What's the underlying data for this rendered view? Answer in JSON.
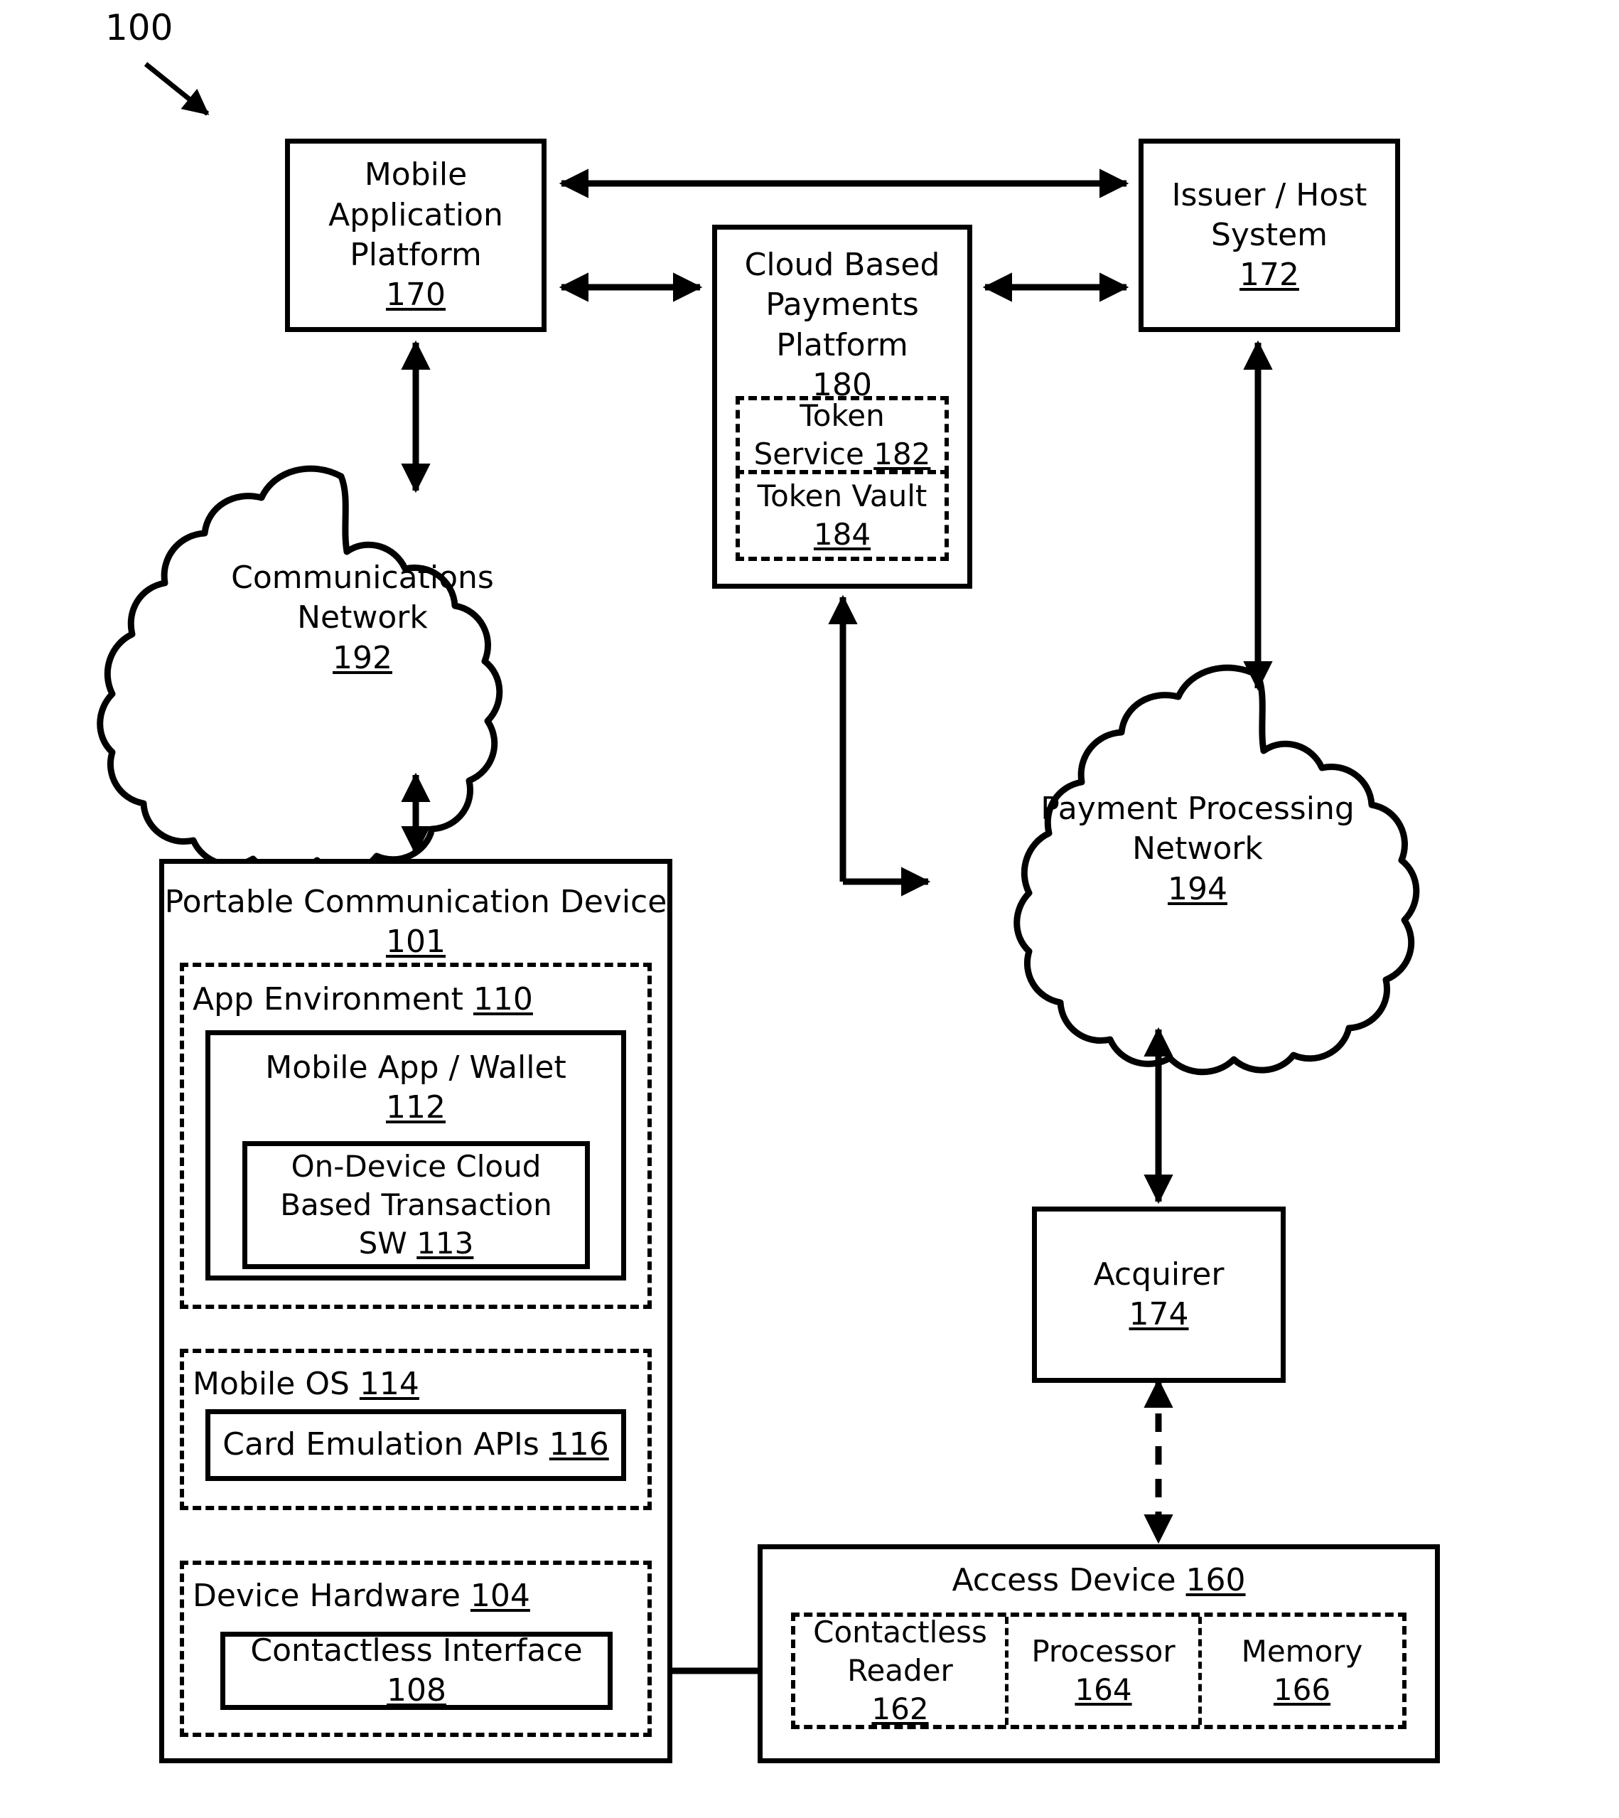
{
  "figure": {
    "number": "100",
    "type": "patent-block-diagram",
    "title": "Cloud Based Payments System Architecture"
  },
  "nodes": {
    "mobile_app_platform": {
      "line1": "Mobile",
      "line2": "Application",
      "line3": "Platform",
      "ref": "170"
    },
    "cloud_payments_platform": {
      "line1": "Cloud Based",
      "line2": "Payments",
      "line3": "Platform",
      "ref": "180"
    },
    "token_service": {
      "line1": "Token",
      "line2": "Service ",
      "ref": "182"
    },
    "token_vault": {
      "line1": "Token Vault",
      "ref": "184"
    },
    "issuer_host": {
      "line1": "Issuer / Host",
      "line2": "System",
      "ref": "172"
    },
    "communications_network": {
      "line1": "Communications",
      "line2": "Network",
      "ref": "192"
    },
    "payment_processing_network": {
      "line1": "Payment Processing",
      "line2": "Network",
      "ref": "194"
    },
    "acquirer": {
      "line1": "Acquirer",
      "ref": "174"
    },
    "portable_communication_device": {
      "line1": "Portable Communication Device",
      "ref": "101"
    },
    "app_environment": {
      "line1": "App Environment ",
      "ref": "110"
    },
    "mobile_app_wallet": {
      "line1": "Mobile App / Wallet",
      "ref": "112"
    },
    "on_device_sw": {
      "line1": "On-Device Cloud",
      "line2": "Based Transaction",
      "line3": "SW ",
      "ref": "113"
    },
    "mobile_os": {
      "line1": "Mobile OS ",
      "ref": "114"
    },
    "card_emulation_apis": {
      "line1": "Card Emulation APIs ",
      "ref": "116"
    },
    "device_hardware": {
      "line1": "Device Hardware ",
      "ref": "104"
    },
    "contactless_interface": {
      "line1": "Contactless Interface ",
      "ref": "108"
    },
    "access_device": {
      "line1": "Access Device ",
      "ref": "160"
    },
    "contactless_reader": {
      "line1": "Contactless",
      "line2": "Reader",
      "ref": "162"
    },
    "processor": {
      "line1": "Processor",
      "ref": "164"
    },
    "memory": {
      "line1": "Memory",
      "ref": "166"
    }
  },
  "connections": [
    {
      "from": "mobile_app_platform",
      "to": "issuer_host",
      "style": "double-arrow"
    },
    {
      "from": "mobile_app_platform",
      "to": "cloud_payments_platform",
      "style": "double-arrow"
    },
    {
      "from": "cloud_payments_platform",
      "to": "issuer_host",
      "style": "double-arrow"
    },
    {
      "from": "mobile_app_platform",
      "to": "communications_network",
      "style": "double-arrow"
    },
    {
      "from": "communications_network",
      "to": "portable_communication_device",
      "style": "double-arrow"
    },
    {
      "from": "cloud_payments_platform",
      "to": "payment_processing_network",
      "style": "single-arrow"
    },
    {
      "from": "issuer_host",
      "to": "payment_processing_network",
      "style": "double-arrow"
    },
    {
      "from": "payment_processing_network",
      "to": "acquirer",
      "style": "double-arrow"
    },
    {
      "from": "acquirer",
      "to": "access_device",
      "style": "dashed-double-arrow"
    },
    {
      "from": "card_emulation_apis",
      "to": "on_device_sw",
      "style": "double-arrow"
    },
    {
      "from": "card_emulation_apis",
      "to": "contactless_interface",
      "style": "double-arrow"
    },
    {
      "from": "contactless_interface",
      "to": "contactless_reader",
      "style": "double-arrow"
    }
  ],
  "colors": {
    "stroke": "#000000",
    "background": "#ffffff"
  }
}
